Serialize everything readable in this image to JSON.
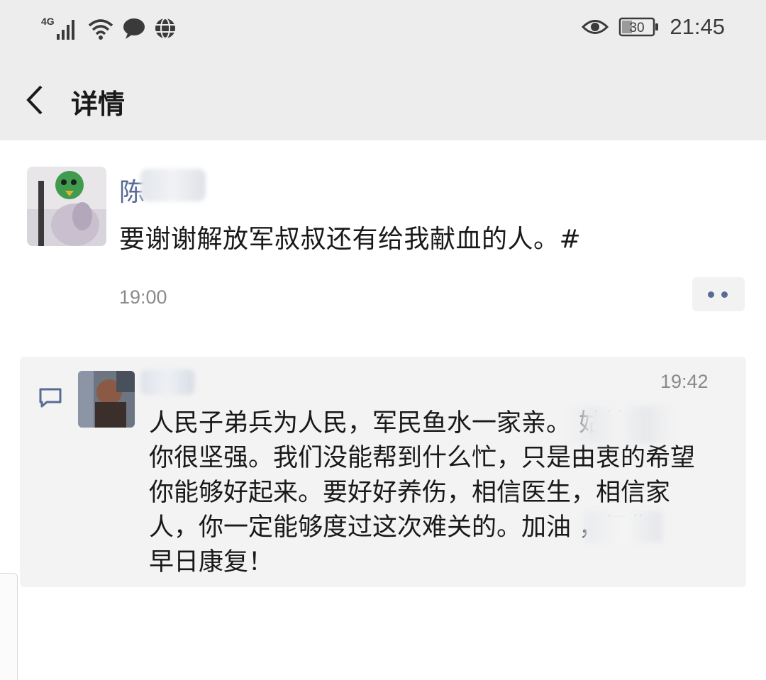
{
  "status_bar": {
    "network": "4G",
    "battery": "30",
    "time": "21:45"
  },
  "nav": {
    "title": "详情"
  },
  "post": {
    "author": "陈",
    "text": "要谢谢解放军叔叔还有给我献血的人。#",
    "time": "19:00"
  },
  "comment": {
    "time": "19:42",
    "text": "人民子弟兵为人民，军民鱼水一家亲。  姑娘，\n你很坚强。我们没能帮到什么忙，只是由衷的希望\n你能够好起来。要好好养伤，相信医生，相信家\n人，你一定能够度过这次难关的。加油    ，祝你\n早日康复！"
  },
  "colors": {
    "link_name": "#576b95",
    "header_bg": "#ededed",
    "comment_bg": "#f3f3f3"
  },
  "icons": [
    "signal-icon",
    "wifi-icon",
    "chat-bubble-icon",
    "globe-icon",
    "eye-icon",
    "battery-icon",
    "back-arrow-icon",
    "comment-icon",
    "more-icon"
  ]
}
